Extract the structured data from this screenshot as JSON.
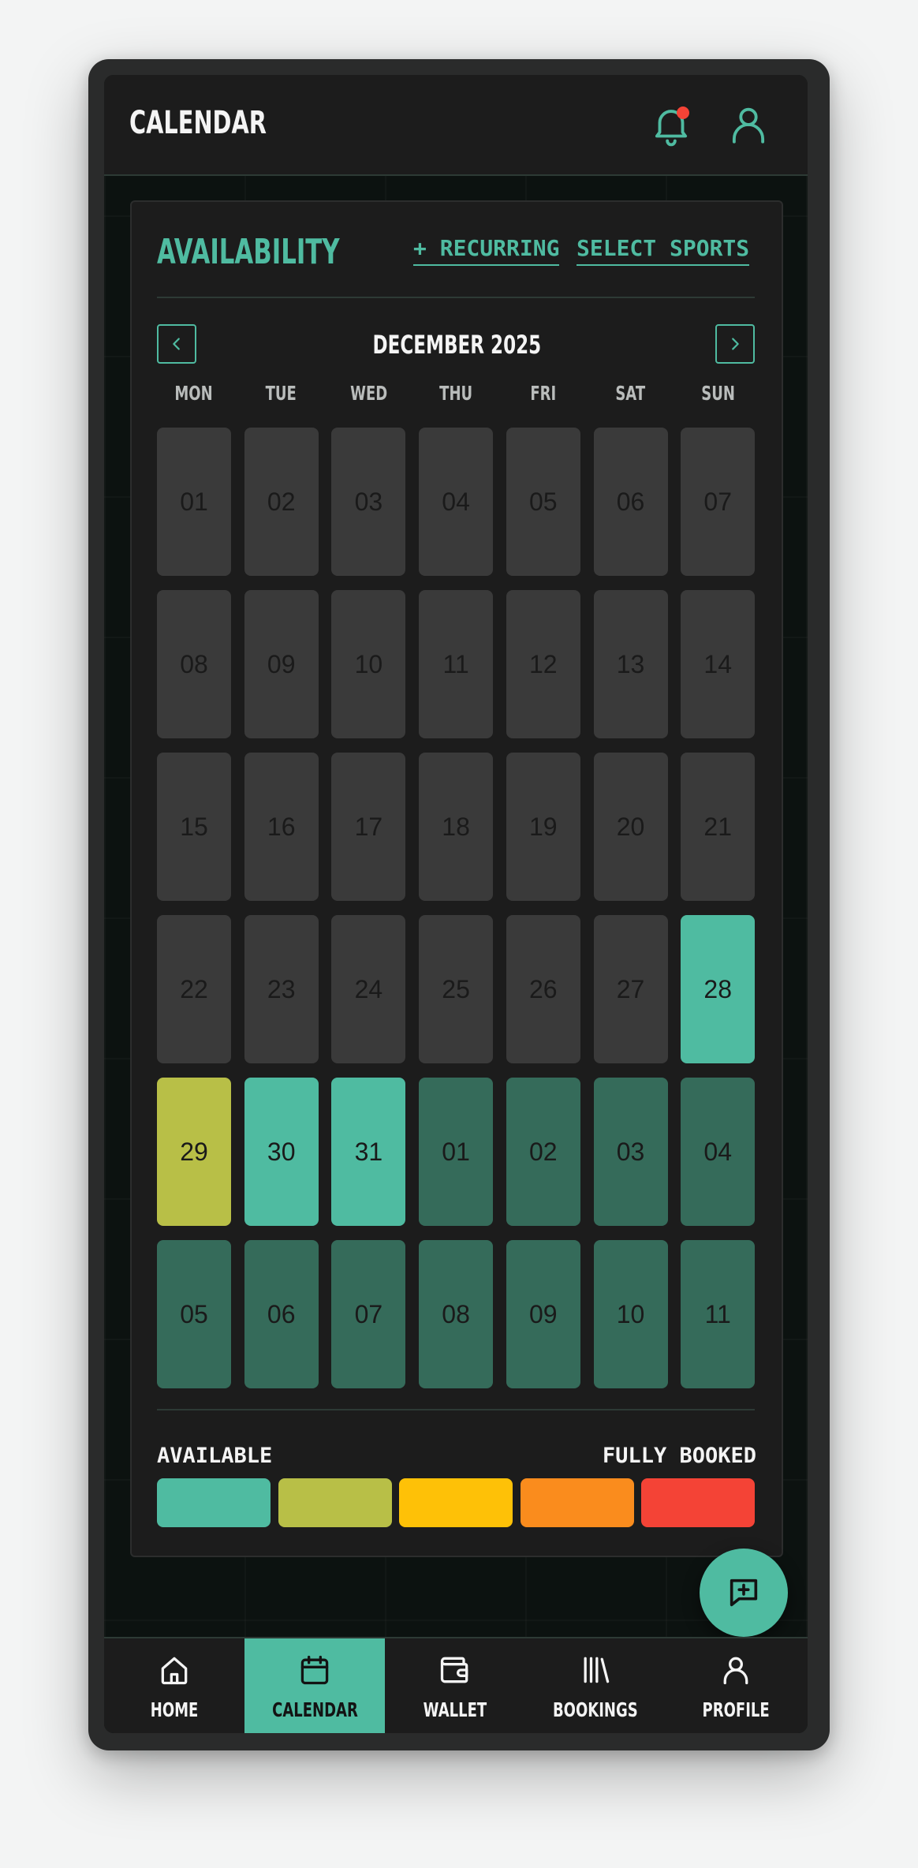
{
  "header": {
    "title": "CALENDAR",
    "icons": [
      "bell-icon",
      "user-icon"
    ],
    "notification_dot": true
  },
  "availability": {
    "title": "AVAILABILITY",
    "recurring_label": "+ RECURRING",
    "select_sports_label": "SELECT SPORTS",
    "month_label": "DECEMBER 2025",
    "weekdays": [
      "MON",
      "TUE",
      "WED",
      "THU",
      "FRI",
      "SAT",
      "SUN"
    ],
    "weeks": [
      [
        {
          "d": "01",
          "s": "past"
        },
        {
          "d": "02",
          "s": "past"
        },
        {
          "d": "03",
          "s": "past"
        },
        {
          "d": "04",
          "s": "past"
        },
        {
          "d": "05",
          "s": "past"
        },
        {
          "d": "06",
          "s": "past"
        },
        {
          "d": "07",
          "s": "past"
        }
      ],
      [
        {
          "d": "08",
          "s": "past"
        },
        {
          "d": "09",
          "s": "past"
        },
        {
          "d": "10",
          "s": "past"
        },
        {
          "d": "11",
          "s": "past"
        },
        {
          "d": "12",
          "s": "past"
        },
        {
          "d": "13",
          "s": "past"
        },
        {
          "d": "14",
          "s": "past"
        }
      ],
      [
        {
          "d": "15",
          "s": "past"
        },
        {
          "d": "16",
          "s": "past"
        },
        {
          "d": "17",
          "s": "past"
        },
        {
          "d": "18",
          "s": "past"
        },
        {
          "d": "19",
          "s": "past"
        },
        {
          "d": "20",
          "s": "past"
        },
        {
          "d": "21",
          "s": "past"
        }
      ],
      [
        {
          "d": "22",
          "s": "past"
        },
        {
          "d": "23",
          "s": "past"
        },
        {
          "d": "24",
          "s": "past"
        },
        {
          "d": "25",
          "s": "past"
        },
        {
          "d": "26",
          "s": "past"
        },
        {
          "d": "27",
          "s": "past"
        },
        {
          "d": "28",
          "s": "available"
        }
      ],
      [
        {
          "d": "29",
          "s": "partial"
        },
        {
          "d": "30",
          "s": "available"
        },
        {
          "d": "31",
          "s": "available"
        },
        {
          "d": "01",
          "s": "next"
        },
        {
          "d": "02",
          "s": "next"
        },
        {
          "d": "03",
          "s": "next"
        },
        {
          "d": "04",
          "s": "next"
        }
      ],
      [
        {
          "d": "05",
          "s": "next"
        },
        {
          "d": "06",
          "s": "next"
        },
        {
          "d": "07",
          "s": "next"
        },
        {
          "d": "08",
          "s": "next"
        },
        {
          "d": "09",
          "s": "next"
        },
        {
          "d": "10",
          "s": "next"
        },
        {
          "d": "11",
          "s": "next"
        }
      ]
    ]
  },
  "status_colors": {
    "past": "#3a3a3a",
    "available": "#4fbba1",
    "partial": "#b8bf47",
    "next": "#356b5a"
  },
  "legend": {
    "left_label": "AVAILABLE",
    "right_label": "FULLY BOOKED",
    "swatches": [
      "#4fbba1",
      "#b8bf47",
      "#fec107",
      "#fa8c1d",
      "#f44336"
    ]
  },
  "fab": {
    "icon": "message-plus-icon"
  },
  "bottom_nav": [
    {
      "label": "HOME",
      "icon": "home-icon",
      "active": false
    },
    {
      "label": "CALENDAR",
      "icon": "calendar-icon",
      "active": true
    },
    {
      "label": "WALLET",
      "icon": "wallet-icon",
      "active": false
    },
    {
      "label": "BOOKINGS",
      "icon": "bookings-icon",
      "active": false
    },
    {
      "label": "PROFILE",
      "icon": "profile-icon",
      "active": false
    }
  ]
}
